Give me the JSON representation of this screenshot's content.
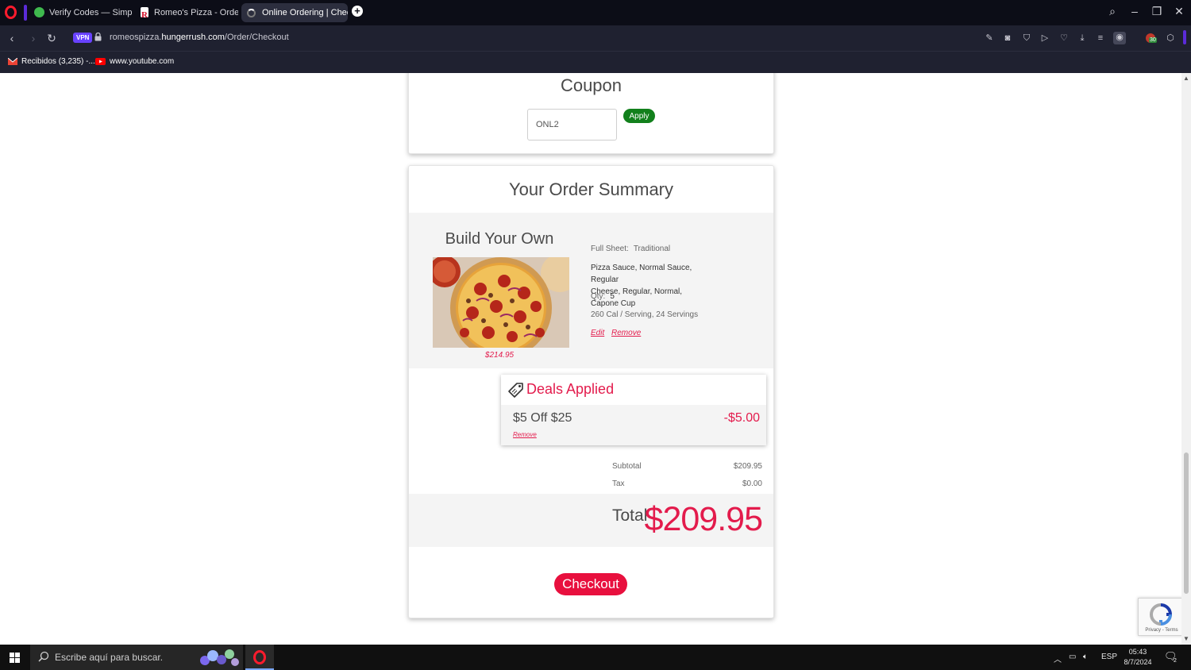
{
  "browser": {
    "tabs": [
      {
        "title": "Verify Codes — SimplyCo",
        "active": false
      },
      {
        "title": "Romeo's Pizza - Order Aw",
        "active": false
      },
      {
        "title": "Online Ordering | Checko",
        "active": true
      }
    ],
    "url_domain_prefix": "romeospizza.",
    "url_domain": "hungerrush.com",
    "url_path": "/Order/Checkout",
    "vpn_label": "VPN",
    "bookmarks": [
      {
        "label": "Recibidos (3,235) -...",
        "icon": "gmail-icon"
      },
      {
        "label": "www.youtube.com",
        "icon": "youtube-icon"
      }
    ],
    "extension_badge": "30"
  },
  "coupon": {
    "title": "Coupon",
    "code_value": "ONL2",
    "apply_label": "Apply"
  },
  "order_summary": {
    "title": "Your Order Summary",
    "item": {
      "name": "Build Your Own",
      "price": "$214.95",
      "size_label": "Full Sheet:",
      "crust": "Traditional",
      "toppings_line1": "Pizza Sauce,  Normal Sauce,  Regular",
      "toppings_line2": "Cheese,  Regular,  Normal,  Capone Cup",
      "qty_label": "Qty:",
      "qty_value": "5",
      "nutrition": "260 Cal / Serving, 24 Servings",
      "edit_label": "Edit",
      "remove_label": "Remove"
    },
    "deals": {
      "title": "Deals Applied",
      "items": [
        {
          "name": "$5 Off $25",
          "amount": "-$5.00",
          "remove_label": "Remove"
        }
      ]
    },
    "subtotal_label": "Subtotal",
    "subtotal_value": "$209.95",
    "tax_label": "Tax",
    "tax_value": "$0.00",
    "total_label": "Total",
    "total_value": "$209.95",
    "checkout_label": "Checkout"
  },
  "recaptcha": {
    "text": "Privacy - Terms"
  },
  "taskbar": {
    "search_placeholder": "Escribe aquí para buscar.",
    "language": "ESP",
    "time": "05:43",
    "date": "8/7/2024",
    "notification_count": "2"
  },
  "colors": {
    "accent_red": "#e31b4c",
    "apply_green": "#12801c",
    "browser_dark": "#0c0d17"
  }
}
